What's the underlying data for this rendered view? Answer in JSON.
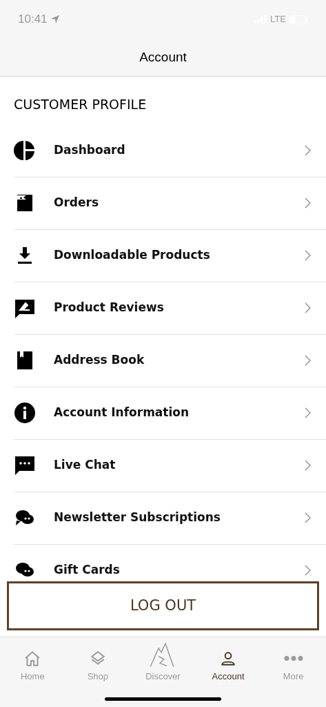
{
  "status_bar": {
    "time": "10:41",
    "network": "LTE"
  },
  "header": {
    "title": "Account"
  },
  "section_title": "CUSTOMER PROFILE",
  "menu_items": [
    {
      "label": "Dashboard"
    },
    {
      "label": "Orders"
    },
    {
      "label": "Downloadable Products"
    },
    {
      "label": "Product Reviews"
    },
    {
      "label": "Address Book"
    },
    {
      "label": "Account Information"
    },
    {
      "label": "Live Chat"
    },
    {
      "label": "Newsletter Subscriptions"
    },
    {
      "label": "Gift Cards"
    }
  ],
  "logout_button": "LOG OUT",
  "tabs": [
    {
      "label": "Home",
      "selected": false
    },
    {
      "label": "Shop",
      "selected": false
    },
    {
      "label": "Discover",
      "selected": false
    },
    {
      "label": "Account",
      "selected": true
    },
    {
      "label": "More",
      "selected": false
    }
  ]
}
